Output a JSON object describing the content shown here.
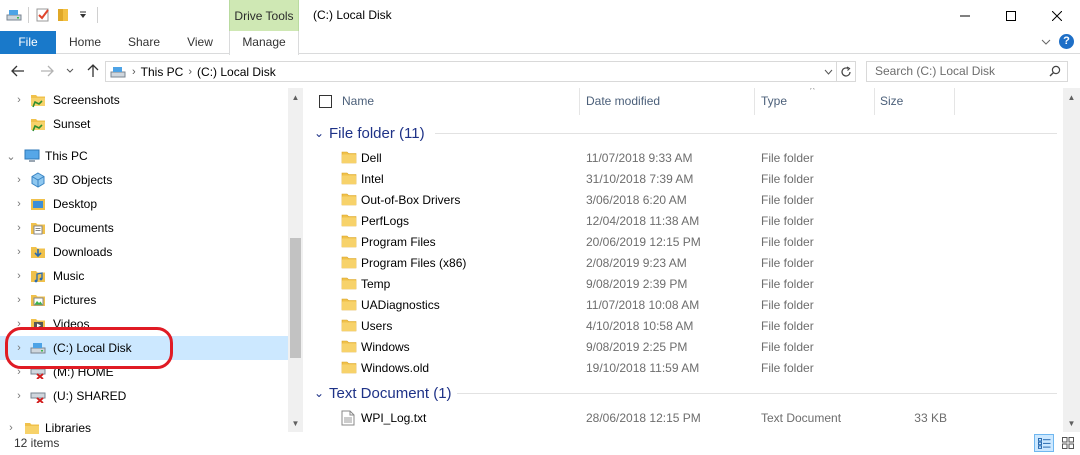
{
  "title_bar": {
    "context_tab": "Drive Tools",
    "window_title": "(C:) Local Disk"
  },
  "ribbon": {
    "tabs": [
      "File",
      "Home",
      "Share",
      "View",
      "Manage"
    ]
  },
  "address_bar": {
    "crumbs": [
      "This PC",
      "(C:) Local Disk"
    ],
    "search_placeholder": "Search (C:) Local Disk"
  },
  "nav_pane": {
    "items": [
      {
        "label": "Screenshots",
        "icon": "folder-quick-access-icon",
        "level": 1,
        "expander": true
      },
      {
        "label": "Sunset",
        "icon": "folder-quick-access-icon",
        "level": 1,
        "expander": false
      },
      {
        "label": "This PC",
        "icon": "computer-icon",
        "level": 0,
        "expander": true,
        "expanded": true
      },
      {
        "label": "3D Objects",
        "icon": "3d-objects-icon",
        "level": 1,
        "expander": true
      },
      {
        "label": "Desktop",
        "icon": "desktop-folder-icon",
        "level": 1,
        "expander": true
      },
      {
        "label": "Documents",
        "icon": "documents-icon",
        "level": 1,
        "expander": true
      },
      {
        "label": "Downloads",
        "icon": "downloads-icon",
        "level": 1,
        "expander": true
      },
      {
        "label": "Music",
        "icon": "music-icon",
        "level": 1,
        "expander": true
      },
      {
        "label": "Pictures",
        "icon": "pictures-icon",
        "level": 1,
        "expander": true
      },
      {
        "label": "Videos",
        "icon": "videos-icon",
        "level": 1,
        "expander": true
      },
      {
        "label": "(C:) Local Disk",
        "icon": "local-disk-icon",
        "level": 1,
        "expander": true,
        "selected": true
      },
      {
        "label": "(M:) HOME",
        "icon": "network-drive-disconnected-icon",
        "level": 1,
        "expander": true
      },
      {
        "label": "(U:) SHARED",
        "icon": "network-drive-disconnected-icon",
        "level": 1,
        "expander": true
      },
      {
        "label": "Libraries",
        "icon": "libraries-icon",
        "level": 0,
        "expander": true
      }
    ]
  },
  "file_list": {
    "columns": [
      "Name",
      "Date modified",
      "Type",
      "Size"
    ],
    "groups": [
      {
        "title": "File folder (11)",
        "rows": [
          {
            "name": "Dell",
            "date": "11/07/2018 9:33 AM",
            "type": "File folder",
            "size": ""
          },
          {
            "name": "Intel",
            "date": "31/10/2018 7:39 AM",
            "type": "File folder",
            "size": ""
          },
          {
            "name": "Out-of-Box Drivers",
            "date": "3/06/2018 6:20 AM",
            "type": "File folder",
            "size": ""
          },
          {
            "name": "PerfLogs",
            "date": "12/04/2018 11:38 AM",
            "type": "File folder",
            "size": ""
          },
          {
            "name": "Program Files",
            "date": "20/06/2019 12:15 PM",
            "type": "File folder",
            "size": ""
          },
          {
            "name": "Program Files (x86)",
            "date": "2/08/2019 9:23 AM",
            "type": "File folder",
            "size": ""
          },
          {
            "name": "Temp",
            "date": "9/08/2019 2:39 PM",
            "type": "File folder",
            "size": ""
          },
          {
            "name": "UADiagnostics",
            "date": "11/07/2018 10:08 AM",
            "type": "File folder",
            "size": ""
          },
          {
            "name": "Users",
            "date": "4/10/2018 10:58 AM",
            "type": "File folder",
            "size": ""
          },
          {
            "name": "Windows",
            "date": "9/08/2019 2:25 PM",
            "type": "File folder",
            "size": ""
          },
          {
            "name": "Windows.old",
            "date": "19/10/2018 11:59 AM",
            "type": "File folder",
            "size": ""
          }
        ]
      },
      {
        "title": "Text Document (1)",
        "rows": [
          {
            "name": "WPI_Log.txt",
            "date": "28/06/2018 12:15 PM",
            "type": "Text Document",
            "size": "33 KB"
          }
        ]
      }
    ]
  },
  "status_bar": {
    "item_count": "12 items"
  },
  "colors": {
    "file_tab": "#1979ca",
    "context_tab": "#cfe8b4",
    "group_header": "#1e3287",
    "selection": "#cce8ff",
    "highlight_ring": "#e01b24"
  }
}
